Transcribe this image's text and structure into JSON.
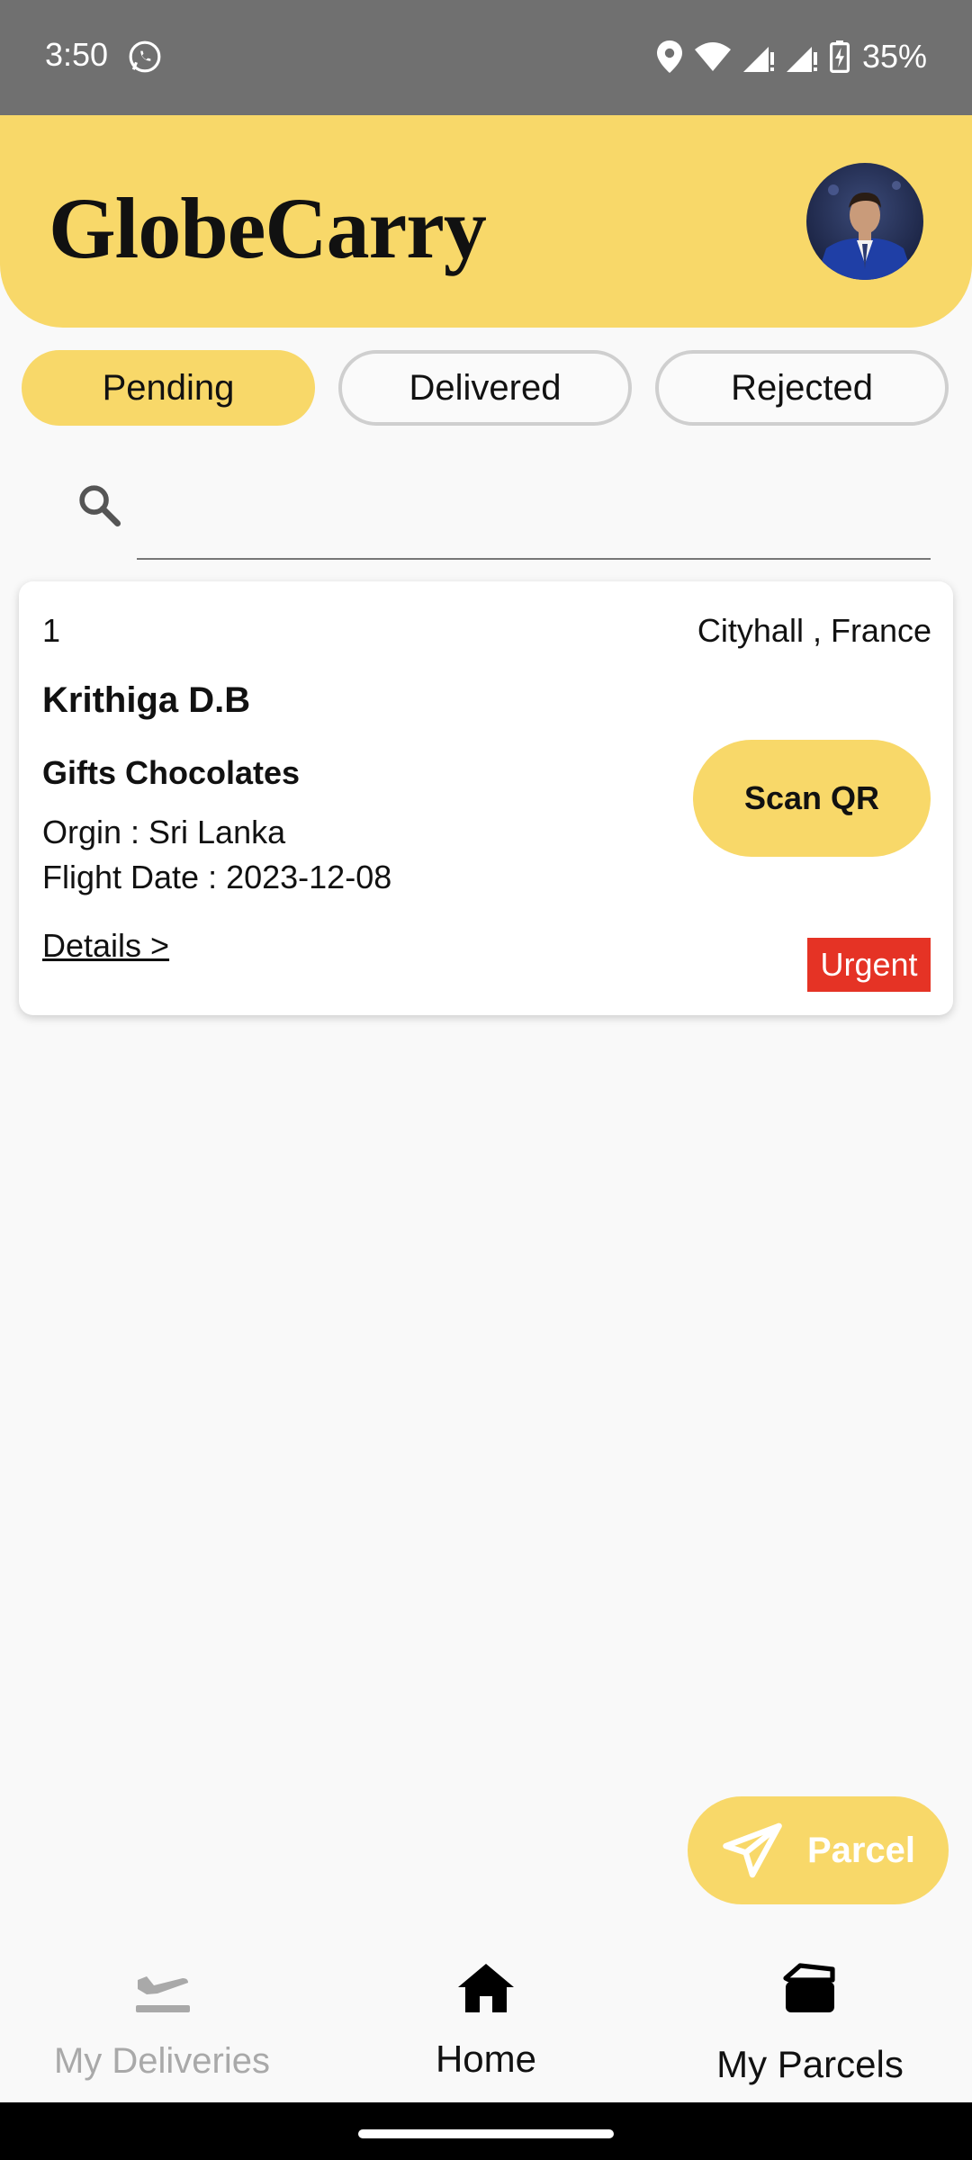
{
  "status_bar": {
    "time": "3:50",
    "battery": "35%"
  },
  "header": {
    "title": "GlobeCarry"
  },
  "tabs": [
    {
      "label": "Pending",
      "active": true
    },
    {
      "label": "Delivered",
      "active": false
    },
    {
      "label": "Rejected",
      "active": false
    }
  ],
  "search": {
    "value": "",
    "placeholder": ""
  },
  "card": {
    "index": "1",
    "location": "Cityhall , France",
    "name": "Krithiga D.B",
    "item": "Gifts Chocolates",
    "origin": "Orgin : Sri Lanka",
    "flight_date": "Flight Date : 2023-12-08",
    "details_link": "Details >",
    "scan_button": "Scan QR",
    "badge": "Urgent"
  },
  "fab": {
    "label": "Parcel"
  },
  "nav": {
    "deliveries": "My Deliveries",
    "home": "Home",
    "parcels": "My Parcels"
  },
  "colors": {
    "accent": "#f8d869",
    "urgent": "#e53325",
    "status_bar": "#707070",
    "background": "#f9f9f9"
  }
}
